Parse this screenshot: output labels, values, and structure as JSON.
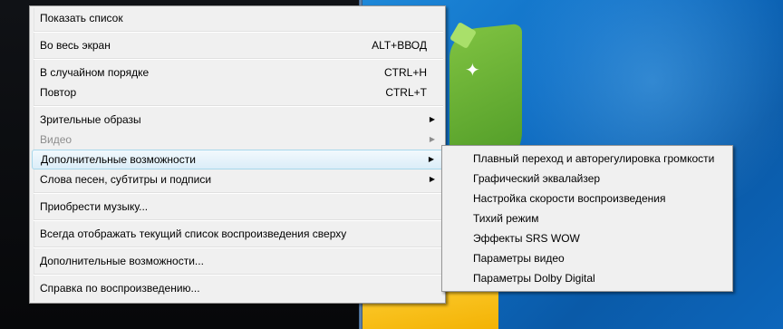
{
  "menu": {
    "items": [
      {
        "label": "Показать список"
      },
      {
        "label": "Во весь экран",
        "shortcut": "ALT+ВВОД"
      },
      {
        "label": "В случайном порядке",
        "shortcut": "CTRL+H"
      },
      {
        "label": "Повтор",
        "shortcut": "CTRL+T"
      },
      {
        "label": "Зрительные образы"
      },
      {
        "label": "Видео"
      },
      {
        "label": "Дополнительные возможности"
      },
      {
        "label": "Слова песен, субтитры и подписи"
      },
      {
        "label": "Приобрести музыку..."
      },
      {
        "label": "Всегда отображать текущий список воспроизведения сверху"
      },
      {
        "label": "Дополнительные возможности..."
      },
      {
        "label": "Справка по воспроизведению..."
      }
    ],
    "submenu_arrow": "▶"
  },
  "submenu": {
    "items": [
      {
        "label": "Плавный переход и авторегулировка громкости"
      },
      {
        "label": "Графический эквалайзер"
      },
      {
        "label": "Настройка скорости воспроизведения"
      },
      {
        "label": "Тихий режим"
      },
      {
        "label": "Эффекты SRS WOW"
      },
      {
        "label": "Параметры видео"
      },
      {
        "label": "Параметры Dolby Digital"
      }
    ]
  }
}
